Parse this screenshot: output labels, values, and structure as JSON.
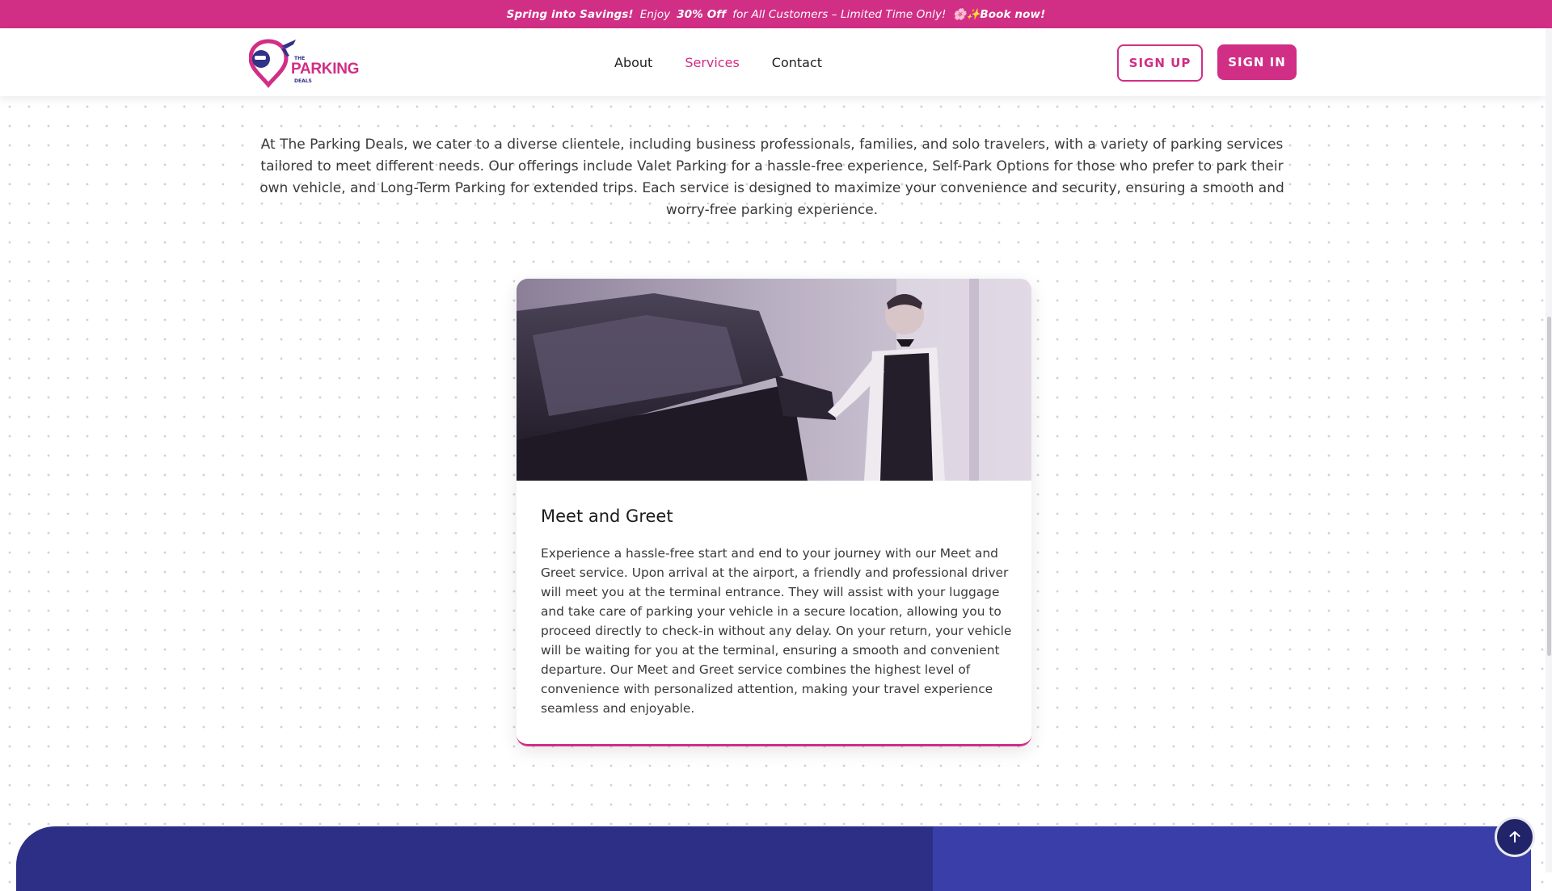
{
  "promo": {
    "bold_lead": "Spring into Savings!",
    "enjoy": "Enjoy",
    "discount": "30% Off",
    "rest": "for All Customers – Limited Time Only!",
    "emoji_flower": "🌸",
    "emoji_sparkle": "✨",
    "cta": "Book now!",
    "bg_color": "#d12e85"
  },
  "header": {
    "logo": {
      "the": "THE",
      "main": "PARKING",
      "sub": "DEALS"
    },
    "nav": [
      {
        "label": "About",
        "active": false
      },
      {
        "label": "Services",
        "active": true
      },
      {
        "label": "Contact",
        "active": false
      }
    ],
    "signup_label": "SIGN UP",
    "signin_label": "SIGN IN"
  },
  "intro_text": "At The Parking Deals, we cater to a diverse clientele, including business professionals, families, and solo travelers, with a variety of parking services tailored to meet different needs. Our offerings include Valet Parking for a hassle-free experience, Self-Park Options for those who prefer to park their own vehicle, and Long-Term Parking for extended trips. Each service is designed to maximize your convenience and security, ensuring a smooth and worry-free parking experience.",
  "service_card": {
    "title": "Meet and Greet",
    "description": "Experience a hassle-free start and end to your journey with our Meet and Greet service. Upon arrival at the airport, a friendly and professional driver will meet you at the terminal entrance. They will assist with your luggage and take care of parking your vehicle in a secure location, allowing you to proceed directly to check-in without any delay. On your return, your vehicle will be waiting for you at the terminal, ensuring a smooth and convenient departure. Our Meet and Greet service combines the highest level of convenience with personalized attention, making your travel experience seamless and enjoyable."
  },
  "colors": {
    "accent": "#d12e85",
    "navy": "#2d2f86",
    "navy_light": "#3a3ea8"
  },
  "icons": {
    "scroll_top": "arrow-up-icon"
  }
}
